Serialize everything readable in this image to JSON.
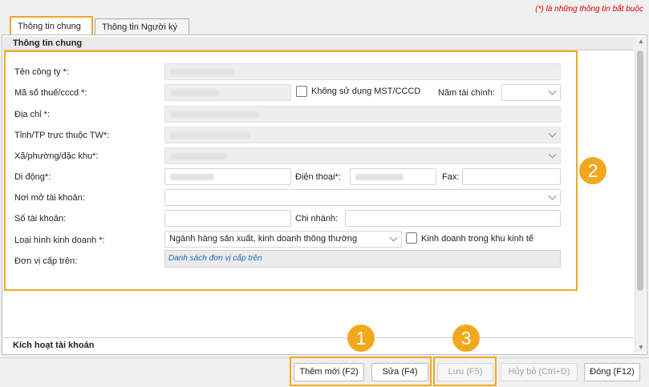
{
  "required_note": "(*) là những thông tin bắt buộc",
  "tabs": [
    {
      "label": "Thông tin chung",
      "active": true
    },
    {
      "label": "Thông tin Người ký",
      "active": false
    }
  ],
  "section_title": "Thông tin chung",
  "form": {
    "company_name_label": "Tên công ty *:",
    "tax_code_label": "Mã số thuế/cccd *:",
    "no_tax_code_checkbox": "Không sử dụng MST/CCCD",
    "fiscal_year_label": "Năm tài chính:",
    "address_label": "Địa chỉ *:",
    "province_label": "Tỉnh/TP trực thuộc TW*:",
    "ward_label": "Xã/phường/đặc khu*:",
    "mobile_label": "Di động*:",
    "phone_label": "Điện thoại*:",
    "fax_label": "Fax:",
    "bank_place_label": "Nơi mở tài khoản:",
    "account_no_label": "Số tài khoản:",
    "branch_label": "Chi nhánh:",
    "business_type_label": "Loại hình kinh doanh *:",
    "business_type_value": "Ngành hàng sản xuất, kinh doanh thông thường",
    "economic_zone_checkbox": "Kinh doanh trong khu kinh tế",
    "parent_unit_label": "Đơn vị cấp trên:",
    "parent_unit_link": "Danh sách đơn vị cấp trên"
  },
  "activate_section": "Kích hoạt tài khoản",
  "buttons": {
    "add": "Thêm mới (F2)",
    "edit": "Sửa (F4)",
    "save": "Lưu (F5)",
    "cancel": "Hủy bỏ (Ctrl+D)",
    "close": "Đóng (F12)"
  },
  "badges": [
    "1",
    "2",
    "3"
  ],
  "colors": {
    "highlight": "#f2a81d",
    "required": "#dd0000",
    "link": "#1e6bb8"
  }
}
